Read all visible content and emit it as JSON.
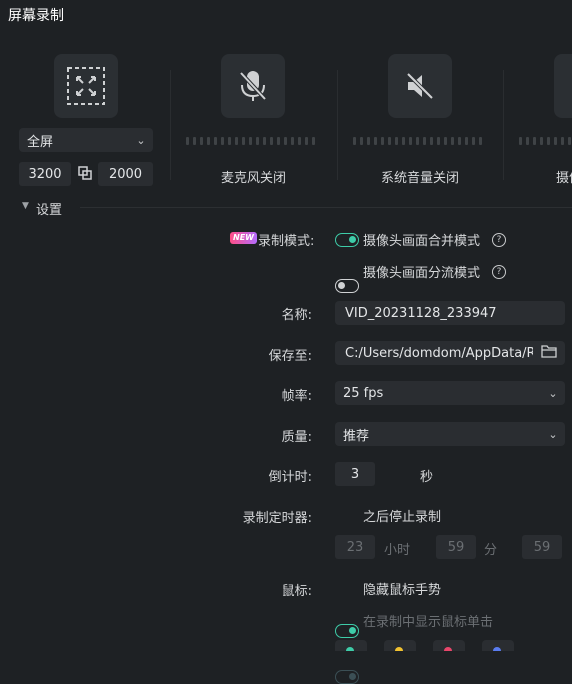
{
  "window": {
    "title": "屏幕录制"
  },
  "region": {
    "mode": "全屏",
    "width": "3200",
    "height": "2000"
  },
  "devices": [
    {
      "label": "麦克风关闭"
    },
    {
      "label": "系统音量关闭"
    },
    {
      "label": "摄像"
    }
  ],
  "settings": {
    "section_label": "设置",
    "new_badge": "NEW",
    "record_mode_label": "录制模式:",
    "mode_merge": "摄像头画面合并模式",
    "mode_split": "摄像头画面分流模式",
    "name_label": "名称:",
    "name_value": "VID_20231128_233947",
    "save_label": "保存至:",
    "save_value": "C:/Users/domdom/AppData/Roa",
    "fps_label": "帧率:",
    "fps_value": "25 fps",
    "quality_label": "质量:",
    "quality_value": "推荐",
    "countdown_label": "倒计时:",
    "countdown_value": "3",
    "countdown_unit": "秒",
    "timer_label": "录制定时器:",
    "timer_text": "之后停止录制",
    "timer_hours": "23",
    "timer_hours_unit": "小时",
    "timer_minutes": "59",
    "timer_minutes_unit": "分",
    "timer_seconds": "59",
    "mouse_label": "鼠标:",
    "mouse_hide": "隐藏鼠标手势",
    "mouse_show_click": "在录制中显示鼠标单击"
  },
  "colors": {
    "accent": "#3ecca8",
    "background": "#1e2124",
    "control": "#2a2d31"
  }
}
